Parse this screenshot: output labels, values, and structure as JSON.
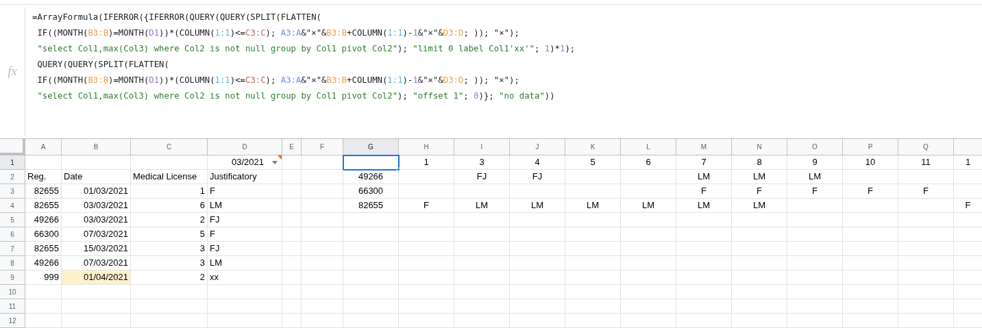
{
  "formula_bar": {
    "label": "fx",
    "lines": [
      [
        {
          "text": "=ArrayFormula(IFERROR({IFERROR(QUERY(QUERY(SPLIT(FLATTEN("
        }
      ],
      [
        {
          "text": " IF((MONTH("
        },
        {
          "text": "B3:B",
          "color": "#f29b4b"
        },
        {
          "text": ")=MONTH("
        },
        {
          "text": "D1",
          "color": "#a374d6"
        },
        {
          "text": "))*(COLUMN("
        },
        {
          "text": "1:1",
          "color": "#56b6e0"
        },
        {
          "text": ")<="
        },
        {
          "text": "C3:C",
          "color": "#c4655a"
        },
        {
          "text": "); "
        },
        {
          "text": "A3:A",
          "color": "#6f8ef0"
        },
        {
          "text": "&\"×\"&"
        },
        {
          "text": "B3:B",
          "color": "#f29b4b"
        },
        {
          "text": "+COLUMN("
        },
        {
          "text": "1:1",
          "color": "#56b6e0"
        },
        {
          "text": ")-"
        },
        {
          "text": "1",
          "color": "#a374d6"
        },
        {
          "text": "&\"×\"&"
        },
        {
          "text": "D3:D",
          "color": "#e7a53c"
        },
        {
          "text": "; )); \"×\");"
        }
      ],
      [
        {
          "text": " \"select Col1,max(Col3) where Col2 is not null group by Col1 pivot Col2\"",
          "color": "#2f7d32"
        },
        {
          "text": "); "
        },
        {
          "text": "\"limit 0 label Col1'xx'\"",
          "color": "#2f7d32"
        },
        {
          "text": "; "
        },
        {
          "text": "1",
          "color": "#a374d6"
        },
        {
          "text": ")*"
        },
        {
          "text": "1",
          "color": "#a374d6"
        },
        {
          "text": ");"
        }
      ],
      [
        {
          "text": " QUERY(QUERY(SPLIT(FLATTEN("
        }
      ],
      [
        {
          "text": " IF((MONTH("
        },
        {
          "text": "B3:B",
          "color": "#f29b4b"
        },
        {
          "text": ")=MONTH("
        },
        {
          "text": "D1",
          "color": "#a374d6"
        },
        {
          "text": "))*(COLUMN("
        },
        {
          "text": "1:1",
          "color": "#56b6e0"
        },
        {
          "text": ")<="
        },
        {
          "text": "C3:C",
          "color": "#c4655a"
        },
        {
          "text": "); "
        },
        {
          "text": "A3:A",
          "color": "#6f8ef0"
        },
        {
          "text": "&\"×\"&"
        },
        {
          "text": "B3:B",
          "color": "#f29b4b"
        },
        {
          "text": "+COLUMN("
        },
        {
          "text": "1:1",
          "color": "#56b6e0"
        },
        {
          "text": ")-"
        },
        {
          "text": "1",
          "color": "#a374d6"
        },
        {
          "text": "&\"×\"&"
        },
        {
          "text": "D3:D",
          "color": "#e7a53c"
        },
        {
          "text": "; )); \"×\");"
        }
      ],
      [
        {
          "text": " \"select Col1,max(Col3) where Col2 is not null group by Col1 pivot Col2\"",
          "color": "#2f7d32"
        },
        {
          "text": "); "
        },
        {
          "text": "\"offset 1\"",
          "color": "#2f7d32"
        },
        {
          "text": "; "
        },
        {
          "text": "0",
          "color": "#a374d6"
        },
        {
          "text": ")}; "
        },
        {
          "text": "\"no data\"",
          "color": "#2f7d32"
        },
        {
          "text": "))"
        }
      ]
    ]
  },
  "columns": [
    {
      "label": "A",
      "selected": false
    },
    {
      "label": "B",
      "selected": false
    },
    {
      "label": "C",
      "selected": false
    },
    {
      "label": "D",
      "selected": false
    },
    {
      "label": "E",
      "selected": false
    },
    {
      "label": "F",
      "selected": false
    },
    {
      "label": "G",
      "selected": true
    },
    {
      "label": "H",
      "selected": false
    },
    {
      "label": "I",
      "selected": false
    },
    {
      "label": "J",
      "selected": false
    },
    {
      "label": "K",
      "selected": false
    },
    {
      "label": "L",
      "selected": false
    },
    {
      "label": "M",
      "selected": false
    },
    {
      "label": "N",
      "selected": false
    },
    {
      "label": "O",
      "selected": false
    },
    {
      "label": "P",
      "selected": false
    },
    {
      "label": "Q",
      "selected": false
    },
    {
      "selected": false
    }
  ],
  "rows": [
    {
      "number": "1",
      "selected": true,
      "cells": {
        "D": {
          "text": "03/2021",
          "kind": "dropdown",
          "note": true,
          "selected": false,
          "highlighted": false
        },
        "G": {
          "note": false,
          "selected": true,
          "highlighted": false
        },
        "H": {
          "text": "1",
          "note": false,
          "selected": false,
          "highlighted": false
        },
        "I": {
          "text": "3",
          "note": false,
          "selected": false,
          "highlighted": false
        },
        "J": {
          "text": "4",
          "note": false,
          "selected": false,
          "highlighted": false
        },
        "K": {
          "text": "5",
          "note": false,
          "selected": false,
          "highlighted": false
        },
        "L": {
          "text": "6",
          "note": false,
          "selected": false,
          "highlighted": false
        },
        "M": {
          "text": "7",
          "note": false,
          "selected": false,
          "highlighted": false
        },
        "N": {
          "text": "8",
          "note": false,
          "selected": false,
          "highlighted": false
        },
        "O": {
          "text": "9",
          "note": false,
          "selected": false,
          "highlighted": false
        },
        "P": {
          "text": "10",
          "note": false,
          "selected": false,
          "highlighted": false
        },
        "Q": {
          "text": "11",
          "note": false,
          "selected": false,
          "highlighted": false
        },
        "R": {
          "text": "1",
          "note": false,
          "selected": false,
          "highlighted": false
        }
      }
    },
    {
      "number": "2",
      "selected": false,
      "cells": {
        "A": {
          "text": "Reg.",
          "kind": "text",
          "note": false,
          "selected": false,
          "highlighted": false
        },
        "B": {
          "text": "Date",
          "kind": "text",
          "note": false,
          "selected": false,
          "highlighted": false
        },
        "C": {
          "text": "Medical License",
          "kind": "text",
          "note": false,
          "selected": false,
          "highlighted": false
        },
        "D": {
          "text": "Justificatory",
          "kind": "text",
          "note": false,
          "selected": false,
          "highlighted": false
        },
        "G": {
          "text": "49266",
          "note": false,
          "selected": false,
          "highlighted": false
        },
        "I": {
          "text": "FJ",
          "note": false,
          "selected": false,
          "highlighted": false
        },
        "J": {
          "text": "FJ",
          "note": false,
          "selected": false,
          "highlighted": false
        },
        "M": {
          "text": "LM",
          "note": false,
          "selected": false,
          "highlighted": false
        },
        "N": {
          "text": "LM",
          "note": false,
          "selected": false,
          "highlighted": false
        },
        "O": {
          "text": "LM",
          "note": false,
          "selected": false,
          "highlighted": false
        }
      }
    },
    {
      "number": "3",
      "selected": false,
      "cells": {
        "A": {
          "text": "82655",
          "kind": "number",
          "note": false,
          "selected": false,
          "highlighted": false
        },
        "B": {
          "text": "01/03/2021",
          "kind": "number",
          "note": false,
          "selected": false,
          "highlighted": false
        },
        "C": {
          "text": "1",
          "kind": "number",
          "note": false,
          "selected": false,
          "highlighted": false
        },
        "D": {
          "text": "F",
          "kind": "text",
          "note": false,
          "selected": false,
          "highlighted": false
        },
        "G": {
          "text": "66300",
          "note": false,
          "selected": false,
          "highlighted": false
        },
        "M": {
          "text": "F",
          "note": false,
          "selected": false,
          "highlighted": false
        },
        "N": {
          "text": "F",
          "note": false,
          "selected": false,
          "highlighted": false
        },
        "O": {
          "text": "F",
          "note": false,
          "selected": false,
          "highlighted": false
        },
        "P": {
          "text": "F",
          "note": false,
          "selected": false,
          "highlighted": false
        },
        "Q": {
          "text": "F",
          "note": false,
          "selected": false,
          "highlighted": false
        }
      }
    },
    {
      "number": "4",
      "selected": false,
      "cells": {
        "A": {
          "text": "82655",
          "kind": "number",
          "note": false,
          "selected": false,
          "highlighted": false
        },
        "B": {
          "text": "03/03/2021",
          "kind": "number",
          "note": false,
          "selected": false,
          "highlighted": false
        },
        "C": {
          "text": "6",
          "kind": "number",
          "note": false,
          "selected": false,
          "highlighted": false
        },
        "D": {
          "text": "LM",
          "kind": "text",
          "note": false,
          "selected": false,
          "highlighted": false
        },
        "G": {
          "text": "82655",
          "note": false,
          "selected": false,
          "highlighted": false
        },
        "H": {
          "text": "F",
          "note": false,
          "selected": false,
          "highlighted": false
        },
        "I": {
          "text": "LM",
          "note": false,
          "selected": false,
          "highlighted": false
        },
        "J": {
          "text": "LM",
          "note": false,
          "selected": false,
          "highlighted": false
        },
        "K": {
          "text": "LM",
          "note": false,
          "selected": false,
          "highlighted": false
        },
        "L": {
          "text": "LM",
          "note": false,
          "selected": false,
          "highlighted": false
        },
        "M": {
          "text": "LM",
          "note": false,
          "selected": false,
          "highlighted": false
        },
        "N": {
          "text": "LM",
          "note": false,
          "selected": false,
          "highlighted": false
        },
        "R": {
          "text": "F",
          "note": false,
          "selected": false,
          "highlighted": false
        }
      }
    },
    {
      "number": "5",
      "selected": false,
      "cells": {
        "A": {
          "text": "49266",
          "kind": "number",
          "note": false,
          "selected": false,
          "highlighted": false
        },
        "B": {
          "text": "03/03/2021",
          "kind": "number",
          "note": false,
          "selected": false,
          "highlighted": false
        },
        "C": {
          "text": "2",
          "kind": "number",
          "note": false,
          "selected": false,
          "highlighted": false
        },
        "D": {
          "text": "FJ",
          "kind": "text",
          "note": false,
          "selected": false,
          "highlighted": false
        }
      }
    },
    {
      "number": "6",
      "selected": false,
      "cells": {
        "A": {
          "text": "66300",
          "kind": "number",
          "note": false,
          "selected": false,
          "highlighted": false
        },
        "B": {
          "text": "07/03/2021",
          "kind": "number",
          "note": false,
          "selected": false,
          "highlighted": false
        },
        "C": {
          "text": "5",
          "kind": "number",
          "note": false,
          "selected": false,
          "highlighted": false
        },
        "D": {
          "text": "F",
          "kind": "text",
          "note": false,
          "selected": false,
          "highlighted": false
        }
      }
    },
    {
      "number": "7",
      "selected": false,
      "cells": {
        "A": {
          "text": "82655",
          "kind": "number",
          "note": false,
          "selected": false,
          "highlighted": false
        },
        "B": {
          "text": "15/03/2021",
          "kind": "number",
          "note": false,
          "selected": false,
          "highlighted": false
        },
        "C": {
          "text": "3",
          "kind": "number",
          "note": false,
          "selected": false,
          "highlighted": false
        },
        "D": {
          "text": "FJ",
          "kind": "text",
          "note": false,
          "selected": false,
          "highlighted": false
        }
      }
    },
    {
      "number": "8",
      "selected": false,
      "cells": {
        "A": {
          "text": "49266",
          "kind": "number",
          "note": false,
          "selected": false,
          "highlighted": false
        },
        "B": {
          "text": "07/03/2021",
          "kind": "number",
          "note": false,
          "selected": false,
          "highlighted": false
        },
        "C": {
          "text": "3",
          "kind": "number",
          "note": false,
          "selected": false,
          "highlighted": false
        },
        "D": {
          "text": "LM",
          "kind": "text",
          "note": false,
          "selected": false,
          "highlighted": false
        }
      }
    },
    {
      "number": "9",
      "selected": false,
      "cells": {
        "A": {
          "text": "999",
          "kind": "number",
          "note": false,
          "selected": false,
          "highlighted": false
        },
        "B": {
          "text": "01/04/2021",
          "kind": "number",
          "note": false,
          "selected": false,
          "highlighted": true
        },
        "C": {
          "text": "2",
          "kind": "number",
          "note": false,
          "selected": false,
          "highlighted": false
        },
        "D": {
          "text": "xx",
          "kind": "text",
          "note": false,
          "selected": false,
          "highlighted": false
        }
      }
    },
    {
      "number": "10",
      "selected": false
    },
    {
      "number": "11",
      "selected": false
    },
    {
      "number": "12",
      "selected": false
    }
  ]
}
